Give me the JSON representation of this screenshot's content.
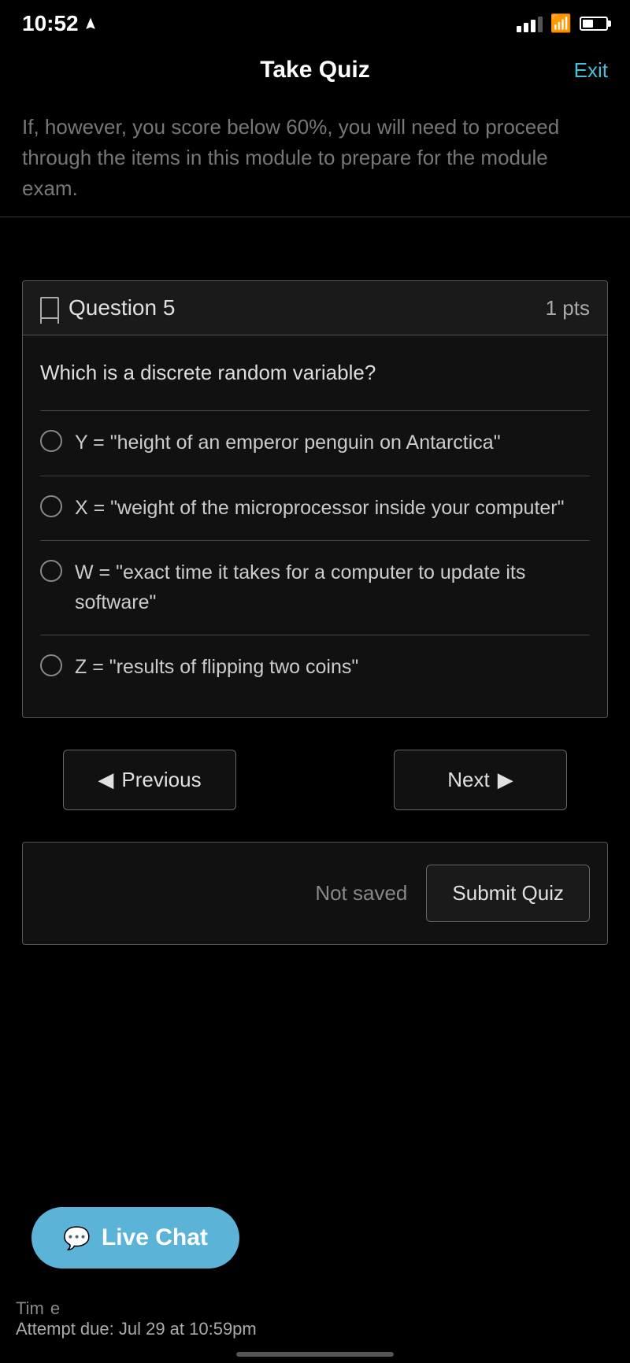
{
  "statusBar": {
    "time": "10:52",
    "location_icon": "location-arrow-icon"
  },
  "navBar": {
    "title": "Take Quiz",
    "exit_label": "Exit"
  },
  "introSection": {
    "partial_text": "If, however, you score below 60%, you will need to proceed through the items in this module to prepare for the module exam."
  },
  "question": {
    "number": "Question 5",
    "points": "1 pts",
    "text": "Which is a discrete random variable?",
    "options": [
      {
        "id": "A",
        "label": "Y = \"height of an emperor penguin on Antarctica\""
      },
      {
        "id": "B",
        "label": "X = \"weight of the microprocessor inside your computer\""
      },
      {
        "id": "C",
        "label": "W = \"exact time it takes for a computer to update its software\""
      },
      {
        "id": "D",
        "label": "Z = \"results of flipping two coins\""
      }
    ]
  },
  "navigation": {
    "previous_label": "Previous",
    "next_label": "Next"
  },
  "submitSection": {
    "not_saved_label": "Not saved",
    "submit_label": "Submit Quiz"
  },
  "liveChat": {
    "label": "Live Chat"
  },
  "bottomInfo": {
    "time_prefix": "Tim",
    "time_suffix": "e",
    "attempt_due": "Attempt due: Jul 29 at 10:59pm"
  }
}
